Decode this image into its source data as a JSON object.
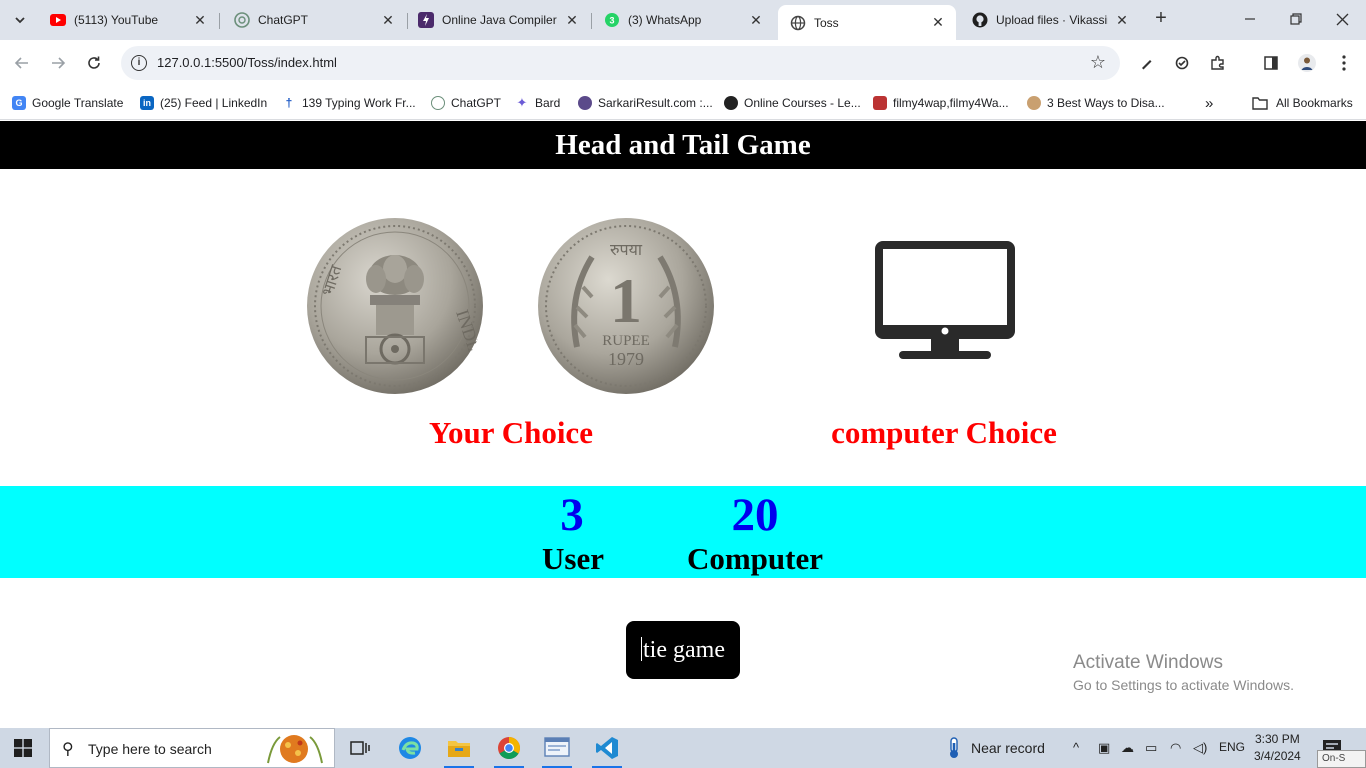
{
  "browser": {
    "tabs": [
      {
        "title": "(5113) YouTube",
        "icon": "youtube-icon",
        "active": false
      },
      {
        "title": "ChatGPT",
        "icon": "chatgpt-icon",
        "active": false
      },
      {
        "title": "Online Java Compiler",
        "icon": "replit-icon",
        "active": false
      },
      {
        "title": "(3) WhatsApp",
        "icon": "whatsapp-icon",
        "active": false
      },
      {
        "title": "Toss",
        "icon": "globe-icon",
        "active": true
      },
      {
        "title": "Upload files · Vikassin",
        "icon": "github-icon",
        "active": false
      }
    ],
    "address_bar": {
      "url": "127.0.0.1:5500/Toss/index.html"
    },
    "bookmarks": [
      {
        "label": "Google Translate",
        "icon": "google-translate-icon"
      },
      {
        "label": "(25) Feed | LinkedIn",
        "icon": "linkedin-icon"
      },
      {
        "label": "139 Typing Work Fr...",
        "icon": "typing-icon"
      },
      {
        "label": "ChatGPT",
        "icon": "chatgpt-icon"
      },
      {
        "label": "Bard",
        "icon": "bard-icon"
      },
      {
        "label": "SarkariResult.com :...",
        "icon": "sarkari-icon"
      },
      {
        "label": "Online Courses - Le...",
        "icon": "courses-icon"
      },
      {
        "label": "filmy4wap,filmy4Wa...",
        "icon": "filmy-icon"
      },
      {
        "label": "3 Best Ways to Disa...",
        "icon": "avatar-icon"
      }
    ],
    "all_bookmarks_label": "All Bookmarks"
  },
  "page": {
    "title": "Head and Tail Game",
    "coins": [
      {
        "name": "head",
        "image": "coin-head-emblem-icon"
      },
      {
        "name": "tail",
        "image": "coin-tail-rupee-icon"
      }
    ],
    "computer_image": "monitor-icon",
    "your_choice_label": "Your Choice",
    "computer_choice_label": "computer Choice",
    "score": {
      "user_value": "3",
      "user_label": "User",
      "computer_value": "20",
      "computer_label": "Computer"
    },
    "result_text": "tie game",
    "colors": {
      "header_bg": "#000000",
      "choice_label": "#ff0000",
      "score_band": "#00ffff",
      "score_number": "#0000ee"
    }
  },
  "watermark": {
    "line1": "Activate Windows",
    "line2": "Go to Settings to activate Windows."
  },
  "taskbar": {
    "search_placeholder": "Type here to search",
    "weather_text": "Near record",
    "language": "ENG",
    "time": "3:30 PM",
    "date": "3/4/2024",
    "onscreen_text": "On-S"
  }
}
